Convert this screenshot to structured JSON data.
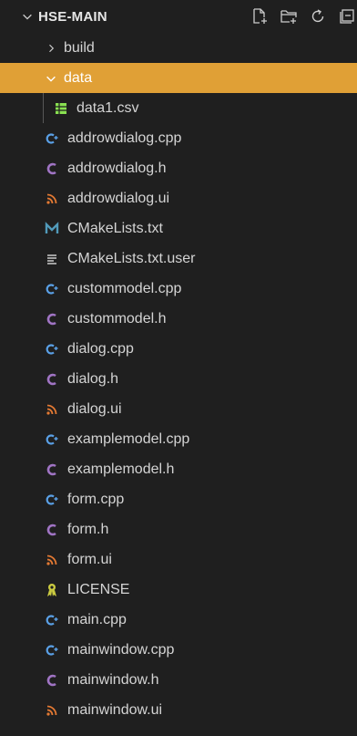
{
  "explorer": {
    "title": "HSE-MAIN",
    "actions": [
      "new-file-icon",
      "new-folder-icon",
      "refresh-icon",
      "collapse-all-icon"
    ]
  },
  "tree": {
    "build": "build",
    "data": "data",
    "data1_csv": "data1.csv",
    "files": [
      {
        "name": "addrowdialog.cpp",
        "type": "cpp"
      },
      {
        "name": "addrowdialog.h",
        "type": "h"
      },
      {
        "name": "addrowdialog.ui",
        "type": "ui"
      },
      {
        "name": "CMakeLists.txt",
        "type": "cmake"
      },
      {
        "name": "CMakeLists.txt.user",
        "type": "user"
      },
      {
        "name": "custommodel.cpp",
        "type": "cpp"
      },
      {
        "name": "custommodel.h",
        "type": "h"
      },
      {
        "name": "dialog.cpp",
        "type": "cpp"
      },
      {
        "name": "dialog.h",
        "type": "h"
      },
      {
        "name": "dialog.ui",
        "type": "ui"
      },
      {
        "name": "examplemodel.cpp",
        "type": "cpp"
      },
      {
        "name": "examplemodel.h",
        "type": "h"
      },
      {
        "name": "form.cpp",
        "type": "cpp"
      },
      {
        "name": "form.h",
        "type": "h"
      },
      {
        "name": "form.ui",
        "type": "ui"
      },
      {
        "name": "LICENSE",
        "type": "license"
      },
      {
        "name": "main.cpp",
        "type": "cpp"
      },
      {
        "name": "mainwindow.cpp",
        "type": "cpp"
      },
      {
        "name": "mainwindow.h",
        "type": "h"
      },
      {
        "name": "mainwindow.ui",
        "type": "ui"
      }
    ]
  },
  "colors": {
    "background": "#1f1f1f",
    "selected": "#e0a036",
    "cpp": "#5aa0e6",
    "h": "#a074c4",
    "ui": "#e37933",
    "cmake": "#519aba",
    "license": "#cbcb41",
    "csv": "#89e051"
  }
}
